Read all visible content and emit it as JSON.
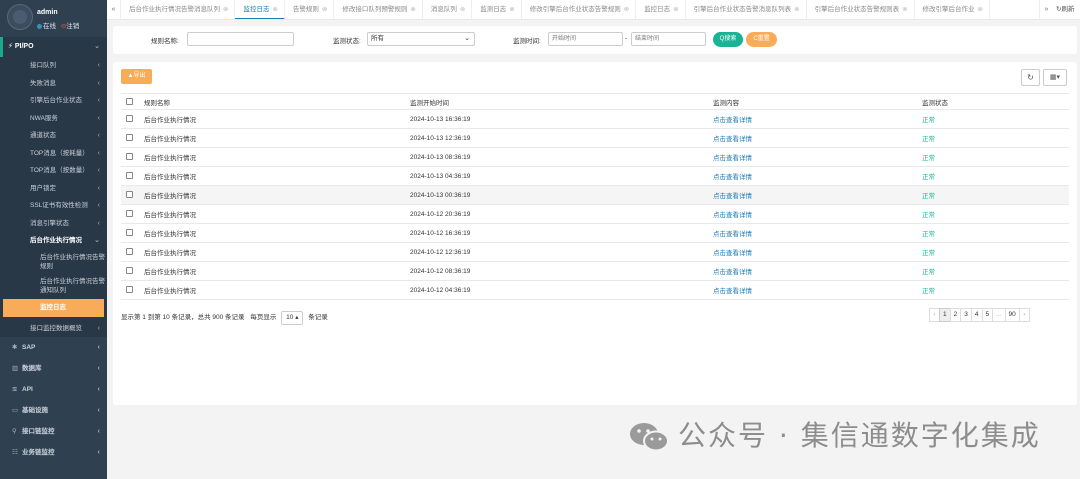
{
  "user": {
    "name": "admin",
    "status_online": "在线",
    "logout": "注销"
  },
  "sidebar": {
    "group_title": "PI/PO",
    "sub_items": [
      {
        "label": "接口队列",
        "has_children": true
      },
      {
        "label": "失败消息",
        "has_children": true
      },
      {
        "label": "引擎后台作业状态",
        "has_children": true
      },
      {
        "label": "NWA服务",
        "has_children": true
      },
      {
        "label": "通道状态",
        "has_children": true
      },
      {
        "label": "TOP消息（按耗量）",
        "has_children": true
      },
      {
        "label": "TOP消息（按数量）",
        "has_children": true
      },
      {
        "label": "用户锁定",
        "has_children": true
      },
      {
        "label": "SSL证书有效性检测",
        "has_children": true
      },
      {
        "label": "消息引擎状态",
        "has_children": true
      }
    ],
    "expanded_item": "后台作业执行情况",
    "expanded_children": [
      "后台作业执行情况告警规则",
      "后台作业执行情况告警通知队列"
    ],
    "active_child": "监控日志",
    "after_item": "接口监控数据概览",
    "main_items": [
      {
        "icon": "✱",
        "label": "SAP"
      },
      {
        "icon": "▥",
        "label": "数据库"
      },
      {
        "icon": "≋",
        "label": "API"
      },
      {
        "icon": "▭",
        "label": "基础设施"
      },
      {
        "icon": "⚲",
        "label": "接口链监控"
      },
      {
        "icon": "☷",
        "label": "业务链监控"
      }
    ]
  },
  "tabs": [
    {
      "label": "后台作业执行情况告警消息队列",
      "active": false
    },
    {
      "label": "监控日志",
      "active": true
    },
    {
      "label": "告警规则",
      "active": false
    },
    {
      "label": "修改接口队列预警规则",
      "active": false
    },
    {
      "label": "消息队列",
      "active": false
    },
    {
      "label": "监测日志",
      "active": false
    },
    {
      "label": "修改引擎后台作业状态告警规则",
      "active": false
    },
    {
      "label": "监控日志",
      "active": false
    },
    {
      "label": "引擎后台作业状态告警消息队列表",
      "active": false
    },
    {
      "label": "引擎后台作业状态告警规则表",
      "active": false
    },
    {
      "label": "修改引擎后台作业",
      "active": false
    }
  ],
  "refresh_label": "刷新",
  "filters": {
    "rule_name_label": "规则名称:",
    "rule_name_value": "",
    "status_label": "监测状态:",
    "status_value": "所有",
    "time_label": "监测时间:",
    "start_placeholder": "开始时间",
    "end_placeholder": "结束时间",
    "search_label": "Q搜索",
    "reset_label": "C重置"
  },
  "toolbar": {
    "export_label": "▲导出",
    "refresh_icon": "refresh-icon",
    "columns_icon": "grid-icon"
  },
  "table": {
    "headers": [
      "规则名称",
      "监测开始时间",
      "监测内容",
      "监测状态"
    ],
    "rows": [
      {
        "name": "后台作业执行情况",
        "time": "2024-10-13 16:36:19",
        "detail": "点击查看详情",
        "status": "正常"
      },
      {
        "name": "后台作业执行情况",
        "time": "2024-10-13 12:36:19",
        "detail": "点击查看详情",
        "status": "正常"
      },
      {
        "name": "后台作业执行情况",
        "time": "2024-10-13 08:36:19",
        "detail": "点击查看详情",
        "status": "正常"
      },
      {
        "name": "后台作业执行情况",
        "time": "2024-10-13 04:36:19",
        "detail": "点击查看详情",
        "status": "正常"
      },
      {
        "name": "后台作业执行情况",
        "time": "2024-10-13 00:36:19",
        "detail": "点击查看详情",
        "status": "正常"
      },
      {
        "name": "后台作业执行情况",
        "time": "2024-10-12 20:36:19",
        "detail": "点击查看详情",
        "status": "正常"
      },
      {
        "name": "后台作业执行情况",
        "time": "2024-10-12 16:36:19",
        "detail": "点击查看详情",
        "status": "正常"
      },
      {
        "name": "后台作业执行情况",
        "time": "2024-10-12 12:36:19",
        "detail": "点击查看详情",
        "status": "正常"
      },
      {
        "name": "后台作业执行情况",
        "time": "2024-10-12 08:36:19",
        "detail": "点击查看详情",
        "status": "正常"
      },
      {
        "name": "后台作业执行情况",
        "time": "2024-10-12 04:36:19",
        "detail": "点击查看详情",
        "status": "正常"
      }
    ]
  },
  "pagination": {
    "info_prefix": "显示第 1 到第 10 条记录，总共 900 条记录",
    "page_size_label": "每页显示",
    "page_size": "10",
    "page_size_suffix": "条记录",
    "pages": [
      "‹",
      "1",
      "2",
      "3",
      "4",
      "5",
      "...",
      "90",
      "›"
    ],
    "current": "1"
  },
  "watermark": "公众号 · 集信通数字化集成",
  "colors": {
    "sidebar": "#2f4050",
    "accent_green": "#1ab394",
    "accent_orange": "#f8ac59",
    "link_blue": "#1a7bb9"
  }
}
